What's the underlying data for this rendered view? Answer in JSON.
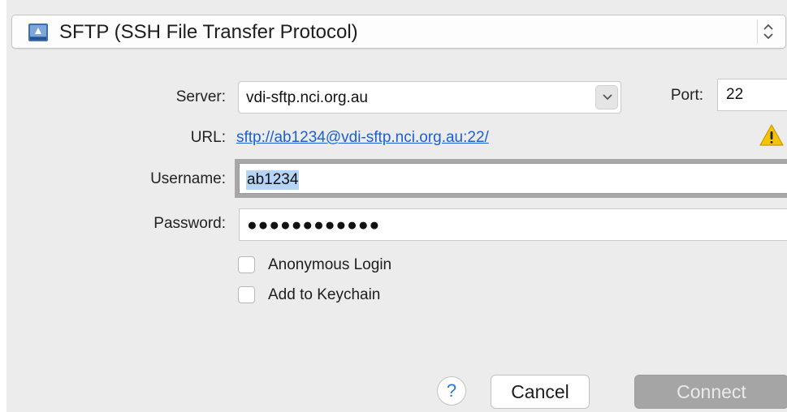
{
  "protocol": {
    "selected": "SFTP (SSH File Transfer Protocol)",
    "icon": "network-drive-icon"
  },
  "form": {
    "server_label": "Server:",
    "server_value": "vdi-sftp.nci.org.au",
    "port_label": "Port:",
    "port_value": "22",
    "url_label": "URL:",
    "url_value": "sftp://ab1234@vdi-sftp.nci.org.au:22/",
    "username_label": "Username:",
    "username_value": "ab1234",
    "password_label": "Password:",
    "password_value": "●●●●●●●●●●●●"
  },
  "options": {
    "anonymous_login": {
      "label": "Anonymous Login",
      "checked": false
    },
    "add_to_keychain": {
      "label": "Add to Keychain",
      "checked": false
    }
  },
  "buttons": {
    "help": "?",
    "cancel": "Cancel",
    "connect": "Connect"
  },
  "colors": {
    "link": "#1b5fd6",
    "selection": "#b6d4f6",
    "disabled_button": "#a5a5a5",
    "warning": "#f5c400"
  }
}
